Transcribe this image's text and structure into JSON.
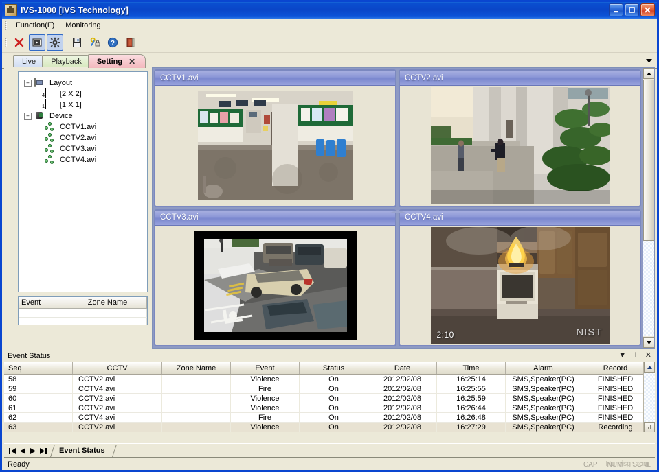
{
  "window": {
    "title": "IVS-1000 [IVS Technology]",
    "icon": "app-icon",
    "minimize": "_",
    "maximize": "□",
    "close": "✕"
  },
  "menubar": {
    "items": [
      {
        "label": "Function(F)"
      },
      {
        "label": "Monitoring"
      }
    ]
  },
  "toolbar": {
    "buttons": [
      {
        "name": "delete-button",
        "icon": "red-x-icon",
        "pressed": false
      },
      {
        "name": "monitor-view-button",
        "icon": "monitor-icon",
        "pressed": true
      },
      {
        "name": "settings-button",
        "icon": "gear-icon",
        "pressed": true
      },
      {
        "name": "save-button",
        "icon": "floppy-disk-icon",
        "pressed": false
      },
      {
        "name": "key-permission-button",
        "icon": "key-lock-icon",
        "pressed": false
      },
      {
        "name": "help-button",
        "icon": "question-mark-icon",
        "pressed": false
      },
      {
        "name": "exit-button",
        "icon": "exit-door-icon",
        "pressed": false
      }
    ]
  },
  "tabs": {
    "items": [
      {
        "label": "Live",
        "active": false
      },
      {
        "label": "Playback",
        "active": false
      },
      {
        "label": "Setting",
        "active": true,
        "close": "✕"
      }
    ],
    "overflow_icon": "chevron-down-icon"
  },
  "tree": {
    "nodes": [
      {
        "label": "Layout",
        "icon": "layout-icon",
        "expander": "-",
        "level": 0
      },
      {
        "label": "[2 X 2]",
        "icon": "grid-2x2-icon",
        "badge": "4",
        "level": 1
      },
      {
        "label": "[1 X 1]",
        "icon": "grid-1x1-icon",
        "badge": "1",
        "level": 1
      },
      {
        "label": "Device",
        "icon": "device-icon",
        "expander": "-",
        "level": 0
      },
      {
        "label": "CCTV1.avi",
        "icon": "camera-node-icon",
        "level": 1
      },
      {
        "label": "CCTV2.avi",
        "icon": "camera-node-icon",
        "level": 1
      },
      {
        "label": "CCTV3.avi",
        "icon": "camera-node-icon",
        "level": 1
      },
      {
        "label": "CCTV4.avi",
        "icon": "camera-node-icon",
        "level": 1
      }
    ]
  },
  "mini_table": {
    "headers": [
      "Event",
      "Zone Name"
    ],
    "rows": []
  },
  "video": {
    "panels": [
      {
        "title": "CCTV1.avi",
        "scene": "indoor-hallway"
      },
      {
        "title": "CCTV2.avi",
        "scene": "outdoor-walkway-assault"
      },
      {
        "title": "CCTV3.avi",
        "scene": "snowy-parking-lot"
      },
      {
        "title": "CCTV4.avi",
        "scene": "kitchen-fire",
        "timestamp": "2:10",
        "watermark": "NIST"
      }
    ]
  },
  "event_status": {
    "panel_title": "Event Status",
    "actions": [
      {
        "name": "panel-dropdown-button",
        "glyph": "▼"
      },
      {
        "name": "panel-pin-button",
        "glyph": "⊥"
      },
      {
        "name": "panel-close-button",
        "glyph": "✕"
      }
    ],
    "columns": [
      "Seq",
      "CCTV",
      "Zone Name",
      "Event",
      "Status",
      "Date",
      "Time",
      "Alarm",
      "Record"
    ],
    "rows": [
      {
        "seq": "58",
        "cctv": "CCTV2.avi",
        "zone": "",
        "event": "Violence",
        "status": "On",
        "date": "2012/02/08",
        "time": "16:25:14",
        "alarm": "SMS,Speaker(PC)",
        "record": "FINISHED",
        "selected": false
      },
      {
        "seq": "59",
        "cctv": "CCTV4.avi",
        "zone": "",
        "event": "Fire",
        "status": "On",
        "date": "2012/02/08",
        "time": "16:25:55",
        "alarm": "SMS,Speaker(PC)",
        "record": "FINISHED",
        "selected": false
      },
      {
        "seq": "60",
        "cctv": "CCTV2.avi",
        "zone": "",
        "event": "Violence",
        "status": "On",
        "date": "2012/02/08",
        "time": "16:25:59",
        "alarm": "SMS,Speaker(PC)",
        "record": "FINISHED",
        "selected": false
      },
      {
        "seq": "61",
        "cctv": "CCTV2.avi",
        "zone": "",
        "event": "Violence",
        "status": "On",
        "date": "2012/02/08",
        "time": "16:26:44",
        "alarm": "SMS,Speaker(PC)",
        "record": "FINISHED",
        "selected": false
      },
      {
        "seq": "62",
        "cctv": "CCTV4.avi",
        "zone": "",
        "event": "Fire",
        "status": "On",
        "date": "2012/02/08",
        "time": "16:26:48",
        "alarm": "SMS,Speaker(PC)",
        "record": "FINISHED",
        "selected": false
      },
      {
        "seq": "63",
        "cctv": "CCTV2.avi",
        "zone": "",
        "event": "Violence",
        "status": "On",
        "date": "2012/02/08",
        "time": "16:27:29",
        "alarm": "SMS,Speaker(PC)",
        "record": "Recording",
        "selected": true
      }
    ]
  },
  "bottom_tabs": {
    "nav": [
      {
        "name": "first-record-button",
        "glyph": "|◀"
      },
      {
        "name": "prev-record-button",
        "glyph": "◀"
      },
      {
        "name": "next-record-button",
        "glyph": "▶"
      },
      {
        "name": "last-record-button",
        "glyph": "▶|"
      }
    ],
    "tabs": [
      {
        "label": "Event Status",
        "active": true
      }
    ]
  },
  "statusbar": {
    "text": "Ready",
    "indicators": [
      "CAP",
      "NUM",
      "SCRL"
    ],
    "watermark": "Numisgr.com"
  }
}
